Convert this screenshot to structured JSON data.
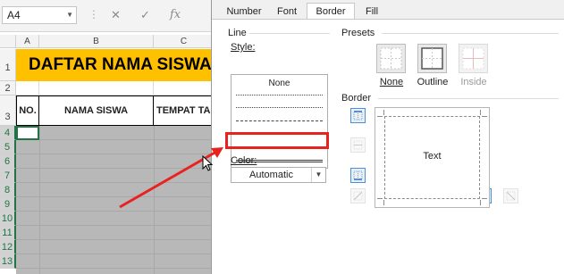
{
  "formula_bar": {
    "name_box_value": "A4",
    "cancel_glyph": "✕",
    "enter_glyph": "✓",
    "function_glyph": "fx"
  },
  "sheet": {
    "columns": [
      "A",
      "B",
      "C"
    ],
    "rows": [
      "1",
      "2",
      "3",
      "4",
      "5",
      "6",
      "7",
      "8",
      "9",
      "10",
      "11",
      "12",
      "13"
    ],
    "title": "DAFTAR NAMA SISWA",
    "headers": [
      "NO.",
      "NAMA SISWA",
      "TEMPAT TA"
    ]
  },
  "dialog": {
    "tabs": [
      "Number",
      "Font",
      "Border",
      "Fill"
    ],
    "active_tab": "Border",
    "line": {
      "group_label": "Line",
      "style_label": "Style:",
      "none_label": "None",
      "color_label": "Color:",
      "color_value": "Automatic"
    },
    "presets": {
      "group_label": "Presets",
      "items": [
        {
          "label": "None",
          "icon": "preset-none-icon",
          "enabled": true
        },
        {
          "label": "Outline",
          "icon": "preset-outline-icon",
          "enabled": true
        },
        {
          "label": "Inside",
          "icon": "preset-inside-icon",
          "enabled": false
        }
      ]
    },
    "border": {
      "group_label": "Border",
      "preview_text": "Text"
    }
  },
  "colors": {
    "excel_green": "#217346",
    "title_fill": "#ffc000",
    "annotation_red": "#e8231f",
    "selection_gray": "#b8b8b8",
    "button_active_blue": "#4a90d9"
  }
}
